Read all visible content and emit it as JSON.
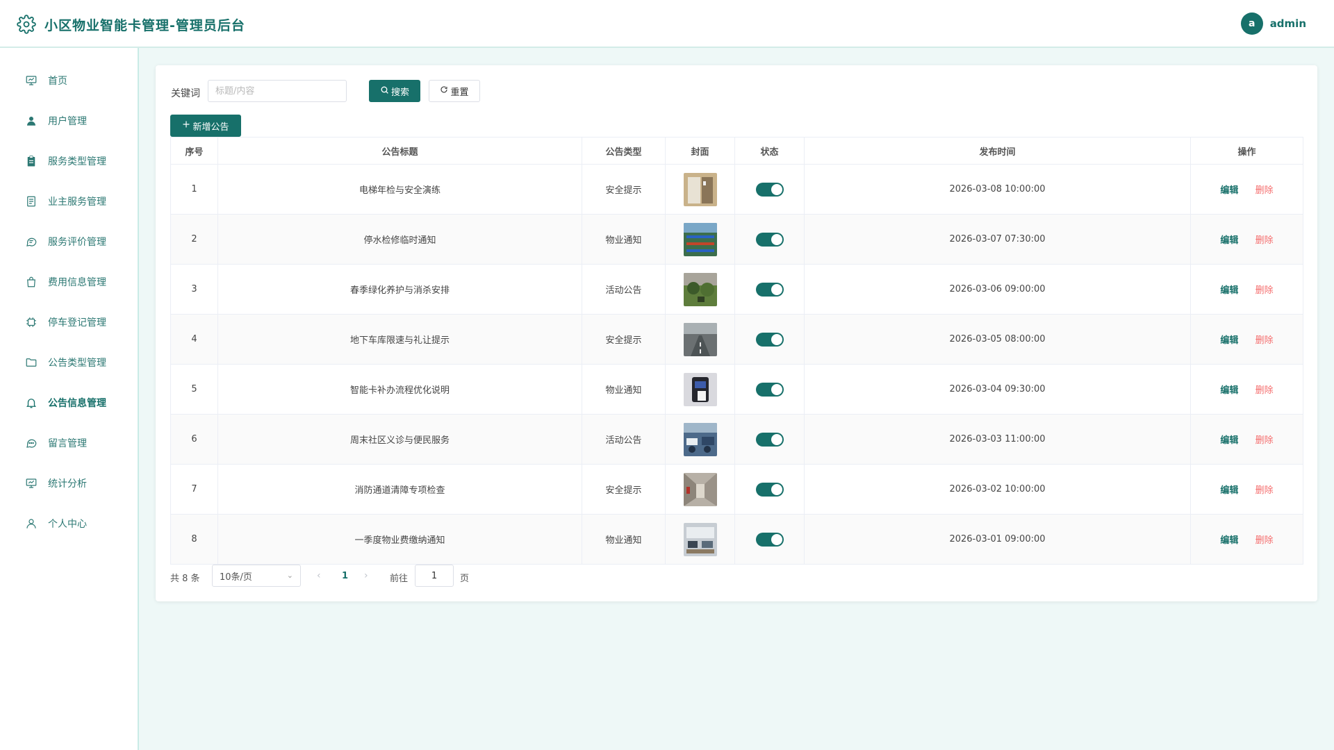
{
  "header": {
    "title": "小区物业智能卡管理-管理员后台",
    "avatar_letter": "a",
    "username": "admin"
  },
  "sidebar": {
    "items": [
      {
        "label": "首页",
        "icon": "presentation-icon"
      },
      {
        "label": "用户管理",
        "icon": "user-icon"
      },
      {
        "label": "服务类型管理",
        "icon": "clipboard-icon"
      },
      {
        "label": "业主服务管理",
        "icon": "document-icon"
      },
      {
        "label": "服务评价管理",
        "icon": "chat-icon"
      },
      {
        "label": "费用信息管理",
        "icon": "bag-icon"
      },
      {
        "label": "停车登记管理",
        "icon": "chip-icon"
      },
      {
        "label": "公告类型管理",
        "icon": "folder-icon"
      },
      {
        "label": "公告信息管理",
        "icon": "bell-icon",
        "active": true
      },
      {
        "label": "留言管理",
        "icon": "message-icon"
      },
      {
        "label": "统计分析",
        "icon": "presentation-icon"
      },
      {
        "label": "个人中心",
        "icon": "person-icon"
      }
    ]
  },
  "search": {
    "label": "关键词",
    "placeholder": "标题/内容",
    "value": "",
    "search_button": "搜索",
    "reset_button": "重置",
    "add_button": "新增公告"
  },
  "table": {
    "columns": [
      "序号",
      "公告标题",
      "公告类型",
      "封面",
      "状态",
      "发布时间",
      "操作"
    ],
    "rows": [
      {
        "no": "1",
        "title": "电梯年检与安全演练",
        "type": "安全提示",
        "cover": "elevator",
        "status": true,
        "time": "2026-03-08 10:00:00"
      },
      {
        "no": "2",
        "title": "停水检修临时通知",
        "type": "物业通知",
        "cover": "pipes",
        "status": true,
        "time": "2026-03-07 07:30:00"
      },
      {
        "no": "3",
        "title": "春季绿化养护与消杀安排",
        "type": "活动公告",
        "cover": "garden",
        "status": true,
        "time": "2026-03-06 09:00:00"
      },
      {
        "no": "4",
        "title": "地下车库限速与礼让提示",
        "type": "安全提示",
        "cover": "garage",
        "status": true,
        "time": "2026-03-05 08:00:00"
      },
      {
        "no": "5",
        "title": "智能卡补办流程优化说明",
        "type": "物业通知",
        "cover": "card-reader",
        "status": true,
        "time": "2026-03-04 09:30:00"
      },
      {
        "no": "6",
        "title": "周末社区义诊与便民服务",
        "type": "活动公告",
        "cover": "clinic",
        "status": true,
        "time": "2026-03-03 11:00:00"
      },
      {
        "no": "7",
        "title": "消防通道清障专项检查",
        "type": "安全提示",
        "cover": "corridor",
        "status": true,
        "time": "2026-03-02 10:00:00"
      },
      {
        "no": "8",
        "title": "一季度物业费缴纳通知",
        "type": "物业通知",
        "cover": "office",
        "status": true,
        "time": "2026-03-01 09:00:00"
      }
    ],
    "edit_label": "编辑",
    "delete_label": "删除"
  },
  "pagination": {
    "total": "共 8 条",
    "page_size": "10条/页",
    "current_page": "1",
    "goto_label": "前往",
    "goto_value": "1",
    "page_suffix": "页"
  },
  "colors": {
    "primary": "#17706a",
    "danger": "#f56c6c",
    "background": "#eef8f7"
  }
}
